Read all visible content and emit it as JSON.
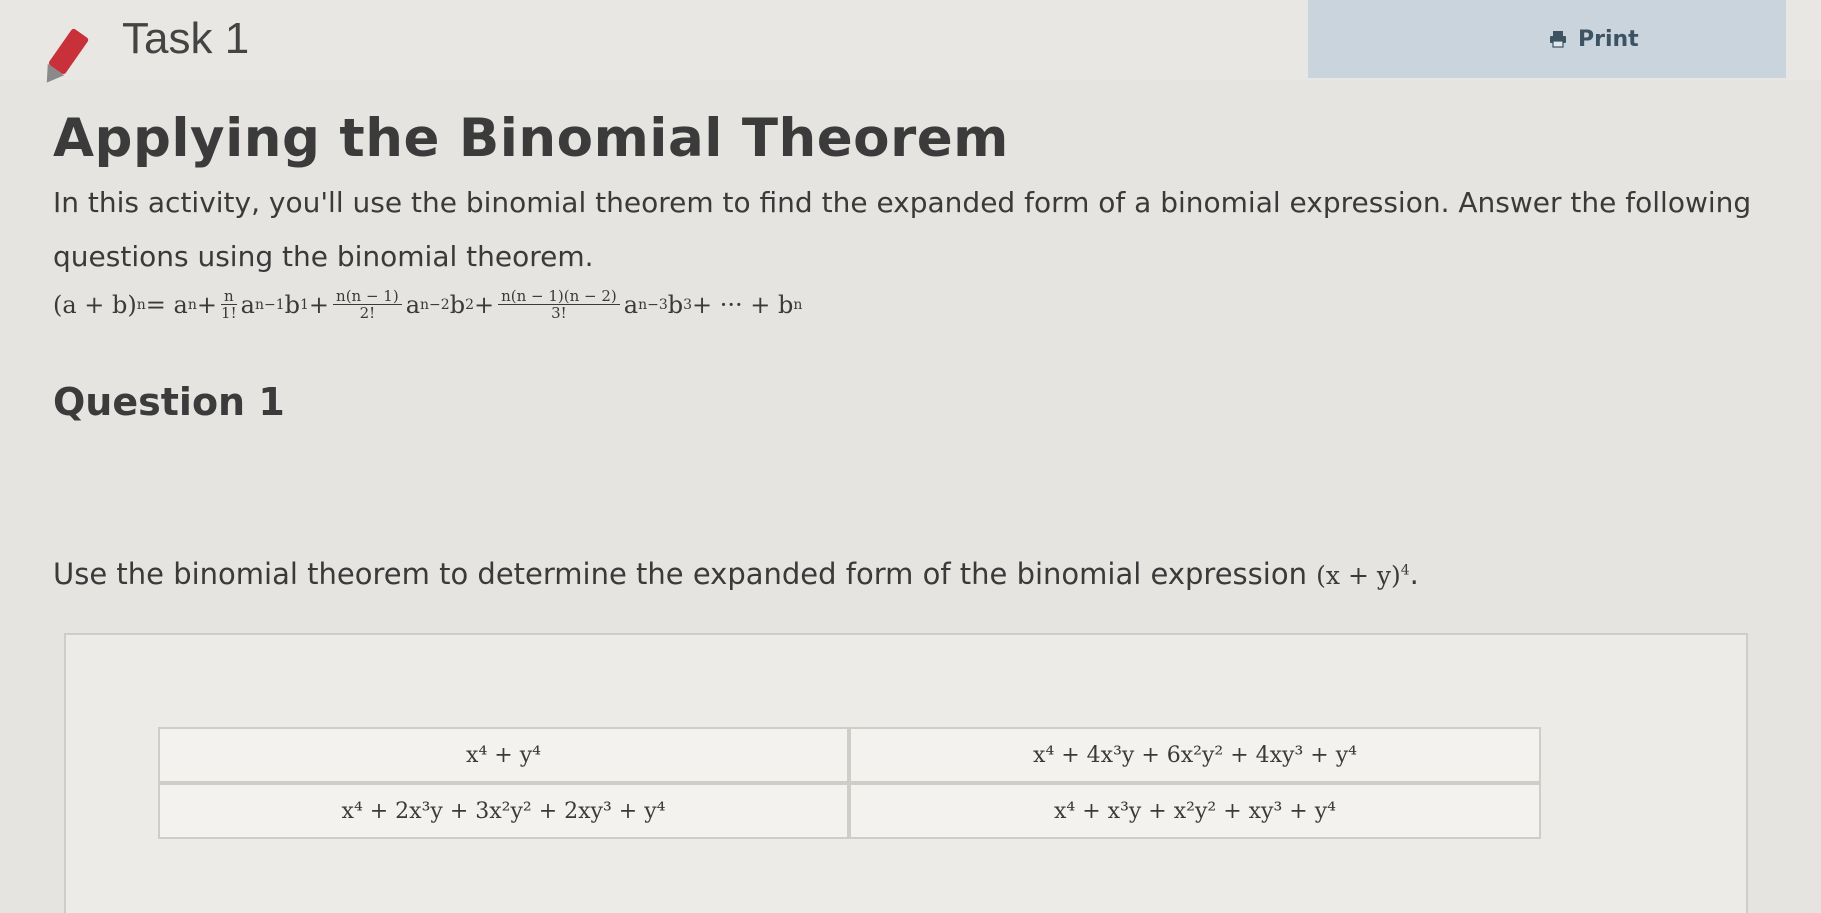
{
  "header": {
    "task_title": "Task 1",
    "print_label": "Print",
    "print_icon": "printer-icon"
  },
  "activity": {
    "title": "Applying the Binomial Theorem",
    "intro": "In this activity, you'll use the binomial theorem to find the expanded form of a binomial expression. Answer the following questions using the binomial theorem."
  },
  "formula": {
    "lhs": "(a + b)",
    "n": "n",
    "eq": " = a",
    "plus": " + ",
    "t1_num": "n",
    "t1_den": "1!",
    "t1_exp_a": "n−1",
    "t1_exp_b": "1",
    "t2_num": "n(n − 1)",
    "t2_den": "2!",
    "t2_exp_a": "n−2",
    "t2_exp_b": "2",
    "t3_num": "n(n − 1)(n − 2)",
    "t3_den": "3!",
    "t3_exp_a": "n−3",
    "t3_exp_b": "3",
    "tail": " + ··· + b"
  },
  "question": {
    "title": "Question 1",
    "text": "Use the binomial theorem to determine the expanded form of the binomial expression ",
    "expr": "(x + y)",
    "expr_exp": "4",
    "end": "."
  },
  "options": [
    "x⁴ + y⁴",
    "x⁴ + 4x³y + 6x²y² + 4xy³ + y⁴",
    "x⁴ + 2x³y + 3x²y² + 2xy³ + y⁴",
    "x⁴ + x³y + x²y² + xy³ + y⁴"
  ],
  "colors": {
    "background": "#e6e4e1",
    "print_bg": "#c9d4dd",
    "pencil": "#c8303a"
  }
}
